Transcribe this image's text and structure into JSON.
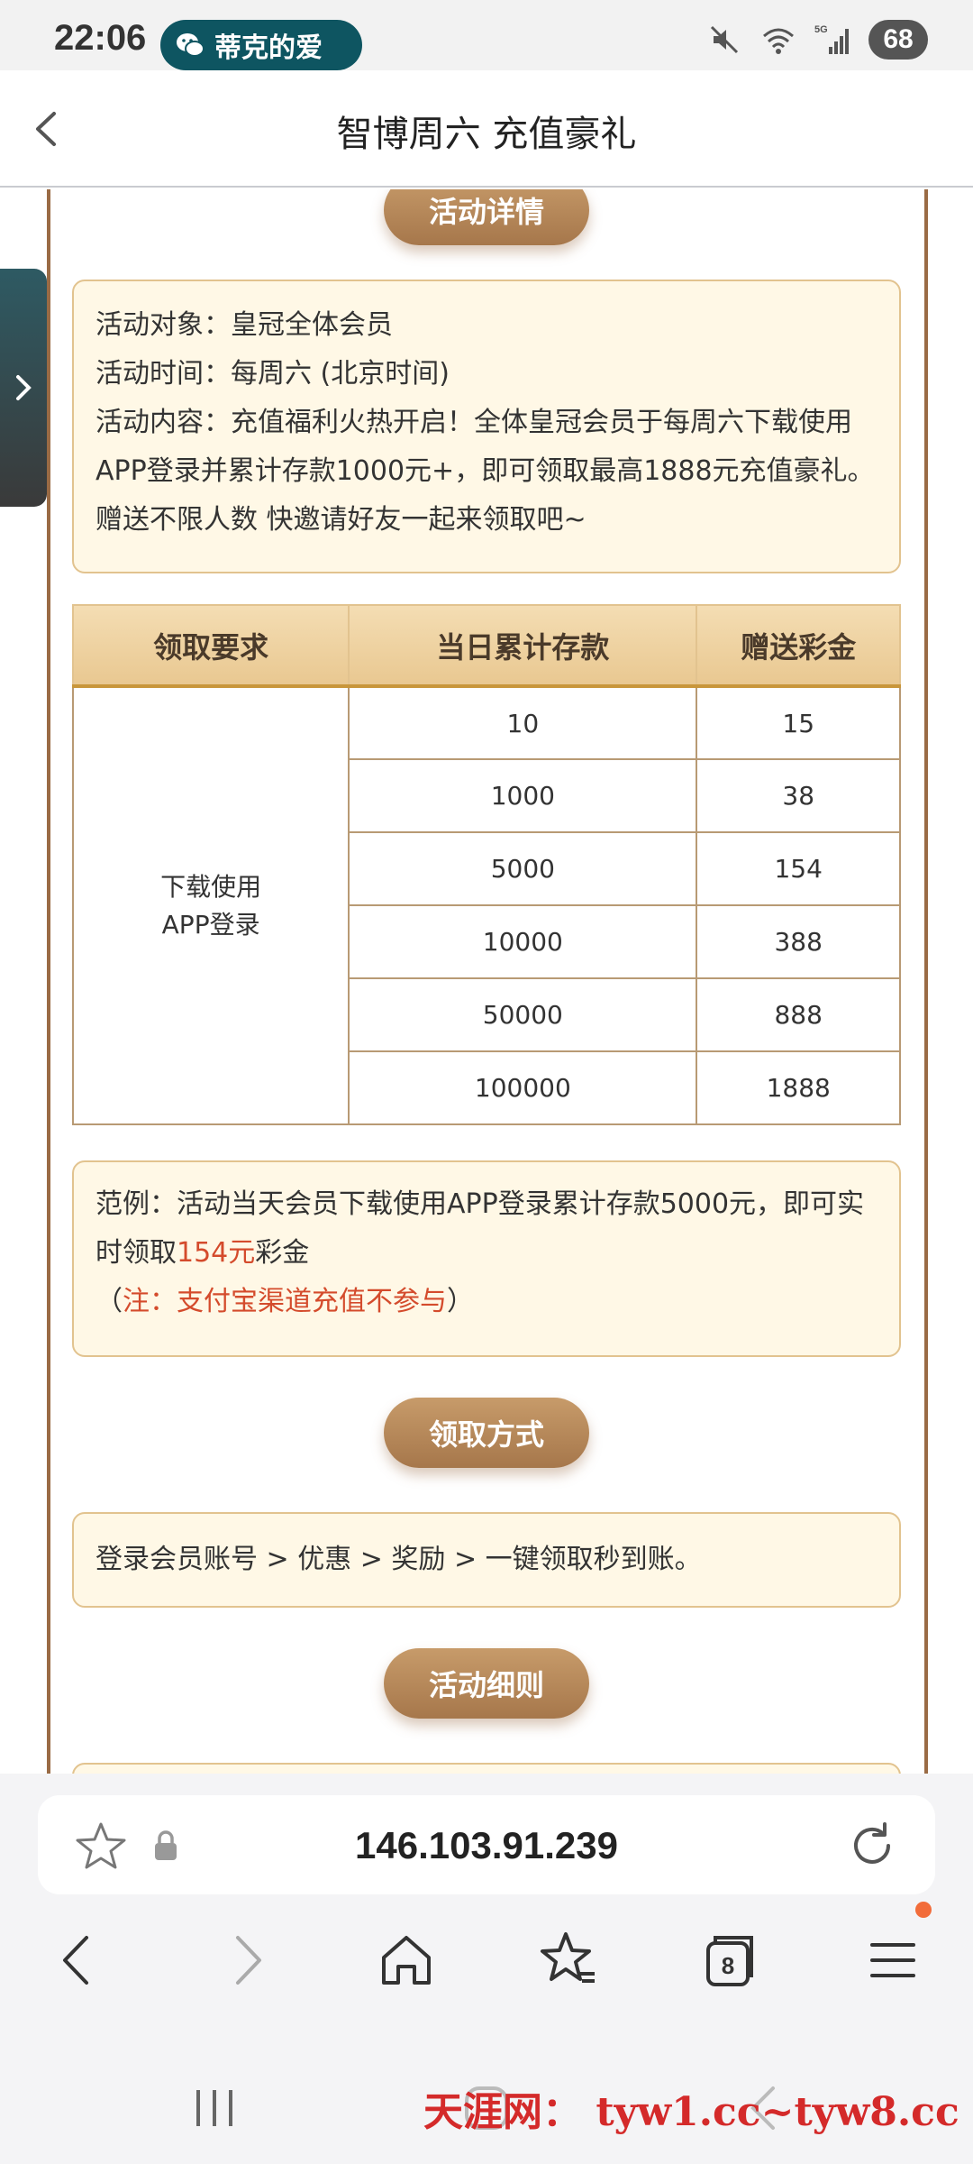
{
  "status_bar": {
    "time": "22:06",
    "notification_pill": "蒂克的爱",
    "battery": "68",
    "network": "5G"
  },
  "header": {
    "title": "智博周六 充值豪礼"
  },
  "sections": {
    "details_button": "活动详情",
    "claim_button": "领取方式",
    "rules_button": "活动细则"
  },
  "details_card": {
    "target": "活动对象：皇冠全体会员",
    "time": "活动时间：每周六 (北京时间)",
    "content_line1": "活动内容：充值福利火热开启！全体皇冠会员于每周六下载使用",
    "content_line2": "APP登录并累计存款1000元+，即可领取最高1888元充值豪礼。",
    "content_line3": "赠送不限人数 快邀请好友一起来领取吧~"
  },
  "table": {
    "headers": [
      "领取要求",
      "当日累计存款",
      "赠送彩金"
    ],
    "requirement_line1": "下载使用",
    "requirement_line2": "APP登录",
    "rows": [
      {
        "deposit": "10",
        "bonus": "15"
      },
      {
        "deposit": "1000",
        "bonus": "38"
      },
      {
        "deposit": "5000",
        "bonus": "154"
      },
      {
        "deposit": "10000",
        "bonus": "388"
      },
      {
        "deposit": "50000",
        "bonus": "888"
      },
      {
        "deposit": "100000",
        "bonus": "1888"
      }
    ]
  },
  "example_card": {
    "line1": "范例：活动当天会员下载使用APP登录累计存款5000元，即可实",
    "line2_prefix": "时领取",
    "line2_highlight": "154元",
    "line2_suffix": "彩金",
    "note_open": "（",
    "note_text": "注：支付宝渠道充值不参与",
    "note_close": "）"
  },
  "claim_card": {
    "text": "登录会员账号 > 优惠 > 奖励 > 一键领取秒到账。"
  },
  "browser": {
    "url": "146.103.91.239",
    "tab_count": "8"
  },
  "watermark": "天涯网：  tyw1.cc~tyw8.cc",
  "colors": {
    "accent_brown": "#a6774b",
    "card_bg": "#fff8e6",
    "card_border": "#e2c38f",
    "highlight_red": "#d44b2c"
  }
}
